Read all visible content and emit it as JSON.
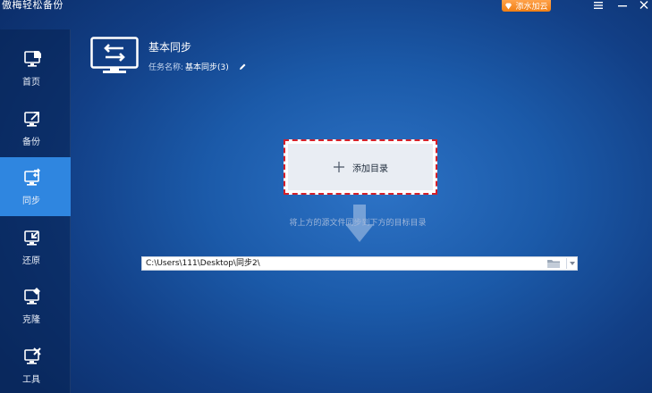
{
  "app": {
    "title": "傲梅轻松备份"
  },
  "titlebar": {
    "upgrade_label": "添水加云"
  },
  "sidebar": {
    "items": [
      {
        "label": "首页",
        "icon": "monitor-home-icon"
      },
      {
        "label": "备份",
        "icon": "monitor-export-icon"
      },
      {
        "label": "同步",
        "icon": "monitor-sync-icon",
        "active": true
      },
      {
        "label": "还原",
        "icon": "monitor-restore-icon"
      },
      {
        "label": "克隆",
        "icon": "monitor-clone-icon"
      },
      {
        "label": "工具",
        "icon": "monitor-tools-icon"
      }
    ]
  },
  "header": {
    "title": "基本同步",
    "task_name_label": "任务名称:",
    "task_name_value": "基本同步(3)"
  },
  "main": {
    "add_directory_label": "添加目录",
    "hint": "将上方的源文件同步到下方的目标目录",
    "destination_path": "C:\\Users\\111\\Desktop\\同步2\\"
  },
  "colors": {
    "accent": "#2f86e0",
    "upgrade": "#f28a1f",
    "highlight_border": "#d4202a"
  }
}
